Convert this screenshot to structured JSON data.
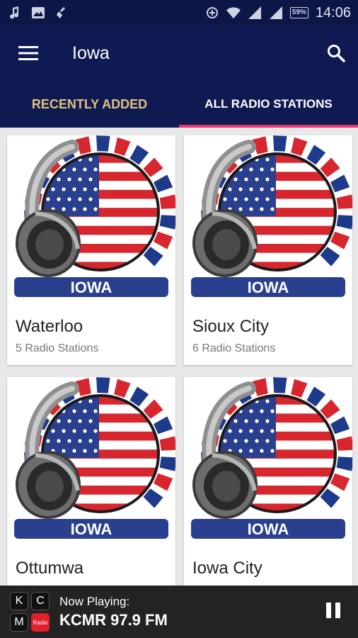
{
  "status_bar": {
    "left_icons": [
      "music-note-icon",
      "image-icon",
      "cleaner-icon"
    ],
    "right_icons": [
      "data-saver-icon",
      "wifi-icon",
      "signal-icon",
      "signal-icon"
    ],
    "battery": "59%",
    "time": "14:06"
  },
  "toolbar": {
    "title": "Iowa",
    "menu_icon": "hamburger-menu-icon",
    "search_icon": "search-icon"
  },
  "tabs": [
    {
      "label": "RECENTLY ADDED",
      "active": false
    },
    {
      "label": "ALL RADIO STATIONS",
      "active": true
    }
  ],
  "cards": [
    {
      "badge": "IOWA",
      "title": "Waterloo",
      "subtitle": "5 Radio Stations"
    },
    {
      "badge": "IOWA",
      "title": "Sioux City",
      "subtitle": "6 Radio Stations"
    },
    {
      "badge": "IOWA",
      "title": "Ottumwa",
      "subtitle": ""
    },
    {
      "badge": "IOWA",
      "title": "Iowa City",
      "subtitle": ""
    }
  ],
  "player": {
    "logo": [
      "K",
      "C",
      "M",
      "Radio"
    ],
    "label": "Now Playing:",
    "station": "KCMR 97.9 FM",
    "control_icon": "pause-icon"
  },
  "colors": {
    "primary": "#0f1a52",
    "accent_tab": "#e0c27a",
    "indicator": "#e8336b",
    "player_bg": "#232323"
  }
}
